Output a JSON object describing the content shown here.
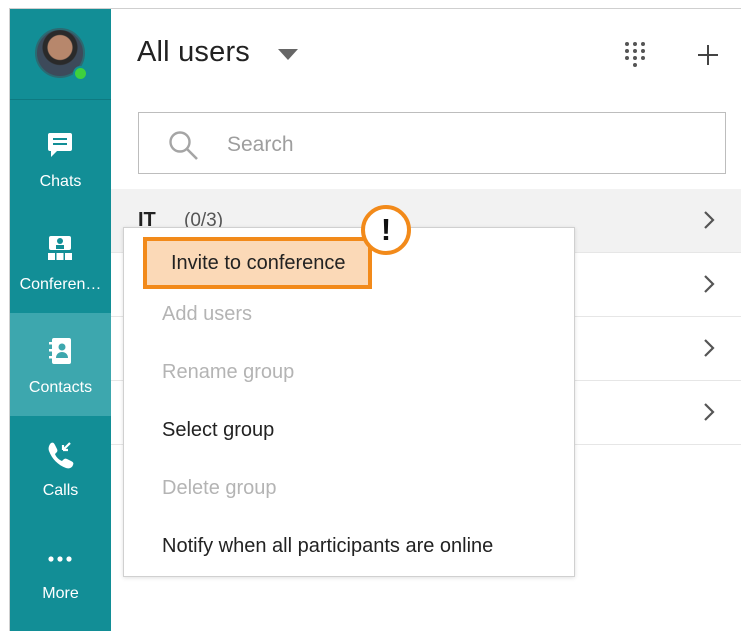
{
  "sidebar": {
    "nav": [
      {
        "label": "Chats",
        "icon": "chat-bubble-icon"
      },
      {
        "label": "Conferen…",
        "icon": "conference-icon"
      },
      {
        "label": "Contacts",
        "icon": "contacts-book-icon",
        "active": true
      },
      {
        "label": "Calls",
        "icon": "phone-call-icon"
      },
      {
        "label": "More",
        "icon": "more-dots-icon"
      }
    ],
    "presence_color": "#3ed13e",
    "bg_color": "#128e96"
  },
  "header": {
    "title": "All users",
    "dialpad_icon": "dialpad-icon",
    "add_icon": "plus-icon"
  },
  "search": {
    "placeholder": "Search"
  },
  "groups": [
    {
      "name": "IT",
      "count": "(0/3)"
    },
    {
      "name": "",
      "count": ""
    },
    {
      "name": "",
      "count": ""
    },
    {
      "name": "",
      "count": ""
    }
  ],
  "context_menu": {
    "items": [
      {
        "label": "Invite to conference",
        "enabled": true,
        "highlighted": true
      },
      {
        "label": "Add users",
        "enabled": false
      },
      {
        "label": "Rename group",
        "enabled": false
      },
      {
        "label": "Select group",
        "enabled": true
      },
      {
        "label": "Delete group",
        "enabled": false
      },
      {
        "label": "Notify when all participants are online",
        "enabled": true
      }
    ]
  },
  "annotation": {
    "badge": "!",
    "accent": "#f28a1a"
  }
}
